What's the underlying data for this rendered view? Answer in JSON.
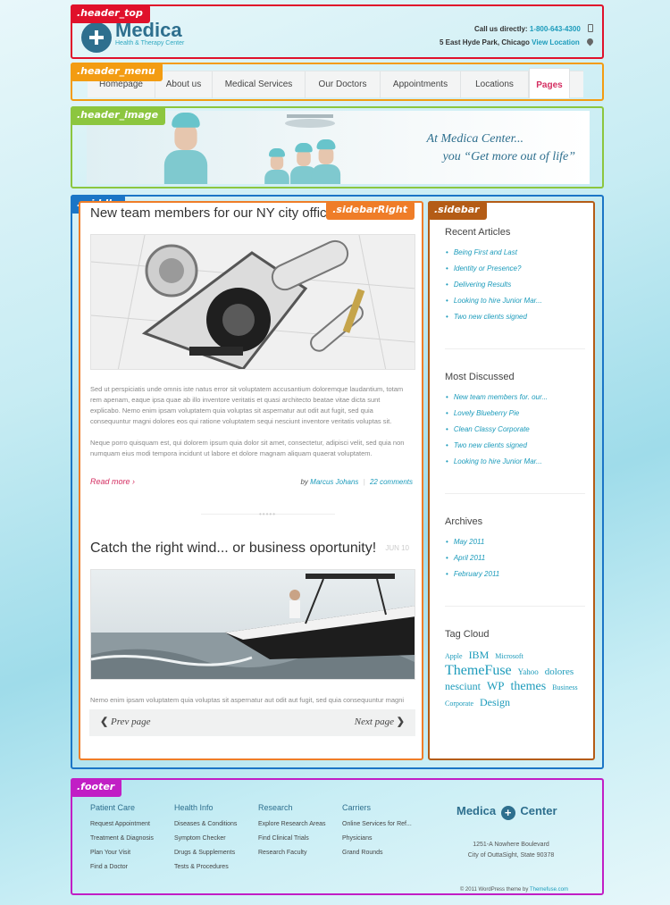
{
  "regions": {
    "header_top": ".header_top",
    "header_menu": ".header_menu",
    "header_image": ".header_image",
    "middle": ".middle",
    "sidebar_right": ".sidebarRight",
    "sidebar": ".sidebar",
    "footer": ".footer"
  },
  "colors": {
    "brand": "#2e6f8e",
    "accent": "#1c9bbb",
    "highlight": "#d42e61"
  },
  "header": {
    "logo_name": "Medica",
    "logo_tagline": "Health & Therapy Center",
    "call_label": "Call us directly:",
    "phone": "1-800-643-4300",
    "address": "5 East Hyde Park, Chicago",
    "view_location": "View Location"
  },
  "menu": [
    {
      "label": "Homepage"
    },
    {
      "label": "About us"
    },
    {
      "label": "Medical Services"
    },
    {
      "label": "Our Doctors"
    },
    {
      "label": "Appointments"
    },
    {
      "label": "Locations"
    },
    {
      "label": "Pages"
    }
  ],
  "banner": {
    "line1": "At Medica  Center...",
    "line2": "you “Get more out of life”"
  },
  "posts": [
    {
      "title": "New team members for our NY city office",
      "para1": "Sed ut perspiciatis unde omnis iste natus error sit voluptatem accusantium doloremque laudantium, totam rem apenam, eaque ipsa quae ab illo inventore veritatis et quasi architecto beatae vitae dicta sunt explicabo. Nemo enim ipsam voluptatem quia voluptas sit aspernatur aut odit aut fugit, sed quia consequuntur magni dolores eos qui ratione voluptatem sequi nesciunt inventore veritatis voluptas sit.",
      "para2": "Neque porro quisquam est, qui dolorem ipsum quia dolor sit amet, consectetur, adipisci velit, sed quia non numquam eius modi tempora incidunt ut labore et dolore magnam aliquam quaerat voluptatem.",
      "read_more": "Read more ›",
      "by": "by",
      "author": "Marcus Johans",
      "comments": "22 comments"
    },
    {
      "title": "Catch the right wind... or business oportunity!",
      "date": "JUN 10",
      "para1": "Nemo enim ipsam voluptatem quia voluptas sit aspernatur aut odit aut fugit, sed quia consequuntur magni"
    }
  ],
  "pager": {
    "prev": "Prev page",
    "next": "Next page"
  },
  "sidebar": {
    "recent_title": "Recent Articles",
    "recent": [
      "Being First and Last",
      "Identity or Presence?",
      "Delivering Results",
      "Looking to hire Junior Mar...",
      "Two new clients signed"
    ],
    "discussed_title": "Most Discussed",
    "discussed": [
      "New team members for. our...",
      "Lovely Blueberry Pie",
      "Clean Classy Corporate",
      "Two new clients signed",
      "Looking to hire Junior Mar..."
    ],
    "archives_title": "Archives",
    "archives": [
      "May 2011",
      "April 2011",
      "February 2011"
    ],
    "tags_title": "Tag Cloud",
    "tags": [
      "Apple",
      "IBM",
      "Microsoft",
      "ThemeFuse",
      "Yahoo",
      "dolores",
      "nesciunt",
      "WP",
      "themes",
      "Business",
      "Corporate",
      "Design"
    ]
  },
  "footer": {
    "columns": [
      {
        "title": "Patient Care",
        "links": [
          "Request Appointment",
          "Treatment & Diagnosis",
          "Plan Your Visit",
          "Find a Doctor"
        ]
      },
      {
        "title": "Health Info",
        "links": [
          "Diseases & Conditions",
          "Symptom Checker",
          "Drugs & Supplements",
          "Tests & Procedures"
        ]
      },
      {
        "title": "Research",
        "links": [
          "Explore Research Areas",
          "Find Clinical Trials",
          "Research Faculty"
        ]
      },
      {
        "title": "Carriers",
        "links": [
          "Online Services for Ref...",
          "Physicians",
          "Grand Rounds"
        ]
      }
    ],
    "logo_left": "Medica",
    "logo_plus": "+",
    "logo_right": "Center",
    "address1": "1251-A Nowhere Boulevard",
    "address2": "City of OuttaSight, State 90378",
    "copyright": "© 2011 WordPress theme by",
    "credit": "Themefuse.com"
  }
}
